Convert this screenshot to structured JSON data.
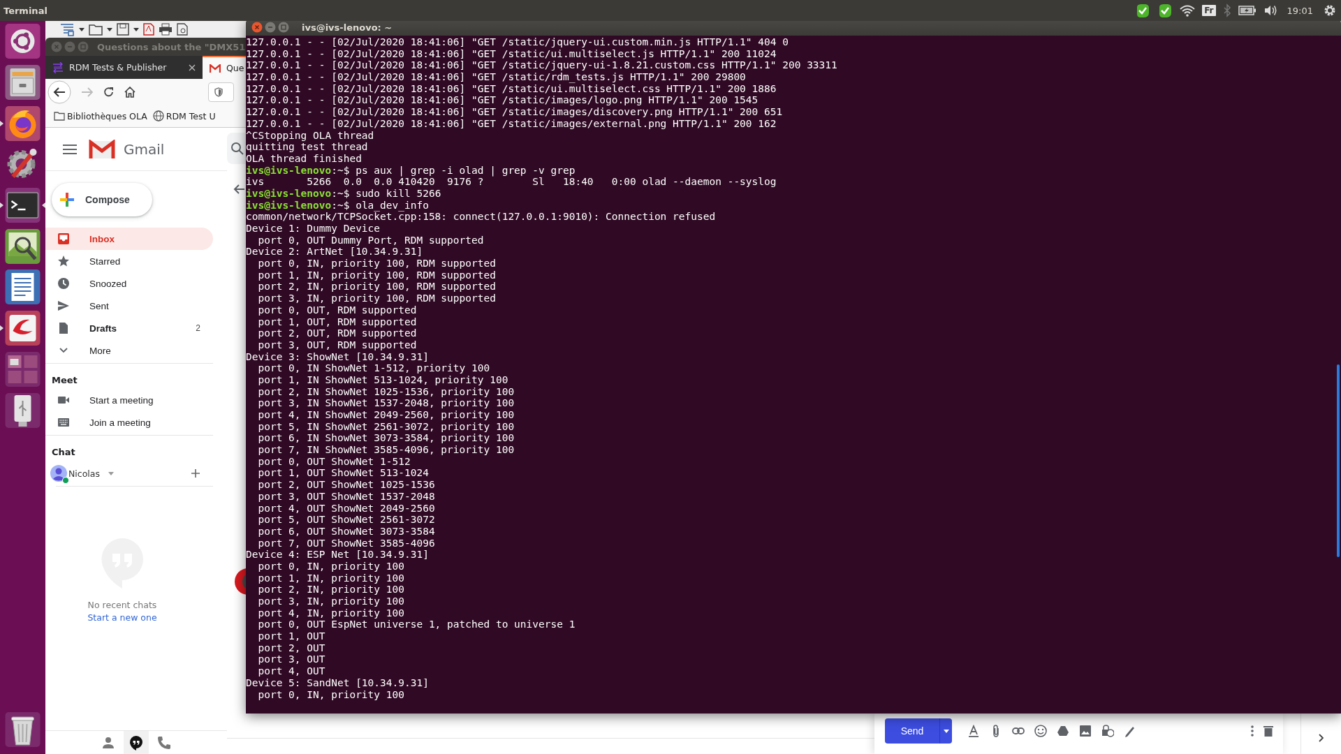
{
  "top_panel": {
    "app_title": "Terminal",
    "indicators": [
      {
        "kind": "check"
      },
      {
        "kind": "check"
      },
      {
        "kind": "wifi"
      },
      {
        "kind": "keyboard",
        "text": "Fr"
      },
      {
        "kind": "bluetooth"
      },
      {
        "kind": "battery"
      },
      {
        "kind": "volume"
      },
      {
        "kind": "clock",
        "text": "19:01"
      },
      {
        "kind": "power"
      }
    ]
  },
  "launcher": {
    "items": [
      {
        "kind": "ubuntu",
        "running": false,
        "focused": false
      },
      {
        "kind": "files",
        "running": false,
        "focused": false
      },
      {
        "kind": "firefox",
        "running": true,
        "focused": false
      },
      {
        "kind": "settings",
        "running": false,
        "focused": false
      },
      {
        "kind": "terminal",
        "running": true,
        "focused": true
      },
      {
        "kind": "imageviewer",
        "running": false,
        "focused": false
      },
      {
        "kind": "writer",
        "running": false,
        "focused": false
      },
      {
        "kind": "reader",
        "running": true,
        "focused": false
      },
      {
        "kind": "workspaces",
        "running": false,
        "focused": false
      },
      {
        "kind": "usb",
        "running": false,
        "focused": false
      }
    ],
    "trash": {
      "kind": "trash"
    }
  },
  "browser": {
    "window_title": "Questions about the \"DMX51",
    "tabs": [
      {
        "label": "RDM Tests & Publisher",
        "kind": "rdm",
        "selected": false
      },
      {
        "label": "Que",
        "kind": "gmail",
        "selected": true
      }
    ],
    "bookmarks": [
      {
        "label": "Bibliothèques OLA",
        "kind": "folder"
      },
      {
        "label": "RDM Test U",
        "kind": "globe"
      }
    ]
  },
  "gmail": {
    "brand": "Gmail",
    "compose": "Compose",
    "nav": [
      {
        "label": "Inbox",
        "kind": "inbox",
        "selected": true,
        "bold": true
      },
      {
        "label": "Starred",
        "kind": "star",
        "selected": false,
        "bold": false
      },
      {
        "label": "Snoozed",
        "kind": "clock",
        "selected": false,
        "bold": false
      },
      {
        "label": "Sent",
        "kind": "send",
        "selected": false,
        "bold": false
      },
      {
        "label": "Drafts",
        "kind": "draft",
        "selected": false,
        "bold": true,
        "count": "2"
      },
      {
        "label": "More",
        "kind": "more",
        "selected": false,
        "bold": false
      }
    ],
    "meet": {
      "heading": "Meet",
      "items": [
        {
          "label": "Start a meeting",
          "kind": "video"
        },
        {
          "label": "Join a meeting",
          "kind": "keyboard"
        }
      ]
    },
    "chat": {
      "heading": "Chat",
      "user": "Nicolas",
      "online": true,
      "empty_text": "No recent chats",
      "link": "Start a new one"
    },
    "bottom_tabs": [
      {
        "kind": "people",
        "selected": false
      },
      {
        "kind": "hangouts",
        "selected": true
      },
      {
        "kind": "phone",
        "selected": false
      }
    ],
    "send": "Send"
  },
  "terminal": {
    "title": "ivs@ivs-lenovo: ~",
    "lines": [
      {
        "kind": "output",
        "text": "127.0.0.1 - - [02/Jul/2020 18:41:06] \"GET /static/jquery-ui.custom.min.js HTTP/1.1\" 404 0"
      },
      {
        "kind": "output",
        "text": "127.0.0.1 - - [02/Jul/2020 18:41:06] \"GET /static/ui.multiselect.js HTTP/1.1\" 200 11024"
      },
      {
        "kind": "output",
        "text": "127.0.0.1 - - [02/Jul/2020 18:41:06] \"GET /static/jquery-ui-1.8.21.custom.css HTTP/1.1\" 200 33311"
      },
      {
        "kind": "output",
        "text": "127.0.0.1 - - [02/Jul/2020 18:41:06] \"GET /static/rdm_tests.js HTTP/1.1\" 200 29800"
      },
      {
        "kind": "output",
        "text": "127.0.0.1 - - [02/Jul/2020 18:41:06] \"GET /static/ui.multiselect.css HTTP/1.1\" 200 1886"
      },
      {
        "kind": "output",
        "text": "127.0.0.1 - - [02/Jul/2020 18:41:06] \"GET /static/images/logo.png HTTP/1.1\" 200 1545"
      },
      {
        "kind": "output",
        "text": "127.0.0.1 - - [02/Jul/2020 18:41:06] \"GET /static/images/discovery.png HTTP/1.1\" 200 651"
      },
      {
        "kind": "output",
        "text": "127.0.0.1 - - [02/Jul/2020 18:41:06] \"GET /static/images/external.png HTTP/1.1\" 200 162"
      },
      {
        "kind": "output",
        "text": "^CStopping OLA thread"
      },
      {
        "kind": "output",
        "text": "quitting test thread"
      },
      {
        "kind": "output",
        "text": "OLA thread finished"
      },
      {
        "kind": "prompt",
        "user": "ivs@ivs-lenovo",
        "path": ":~$",
        "text": "ps aux | grep -i olad | grep -v grep"
      },
      {
        "kind": "output",
        "text": "ivs       5266  0.0  0.0 410420  9176 ?        Sl   18:40   0:00 olad --daemon --syslog"
      },
      {
        "kind": "prompt",
        "user": "ivs@ivs-lenovo",
        "path": ":~$",
        "text": "sudo kill 5266"
      },
      {
        "kind": "prompt",
        "user": "ivs@ivs-lenovo",
        "path": ":~$",
        "text": "ola_dev_info"
      },
      {
        "kind": "output",
        "text": "common/network/TCPSocket.cpp:158: connect(127.0.0.1:9010): Connection refused"
      },
      {
        "kind": "output",
        "text": "Device 1: Dummy Device"
      },
      {
        "kind": "output",
        "text": "  port 0, OUT Dummy Port, RDM supported"
      },
      {
        "kind": "output",
        "text": "Device 2: ArtNet [10.34.9.31]"
      },
      {
        "kind": "output",
        "text": "  port 0, IN, priority 100, RDM supported"
      },
      {
        "kind": "output",
        "text": "  port 1, IN, priority 100, RDM supported"
      },
      {
        "kind": "output",
        "text": "  port 2, IN, priority 100, RDM supported"
      },
      {
        "kind": "output",
        "text": "  port 3, IN, priority 100, RDM supported"
      },
      {
        "kind": "output",
        "text": "  port 0, OUT, RDM supported"
      },
      {
        "kind": "output",
        "text": "  port 1, OUT, RDM supported"
      },
      {
        "kind": "output",
        "text": "  port 2, OUT, RDM supported"
      },
      {
        "kind": "output",
        "text": "  port 3, OUT, RDM supported"
      },
      {
        "kind": "output",
        "text": "Device 3: ShowNet [10.34.9.31]"
      },
      {
        "kind": "output",
        "text": "  port 0, IN ShowNet 1-512, priority 100"
      },
      {
        "kind": "output",
        "text": "  port 1, IN ShowNet 513-1024, priority 100"
      },
      {
        "kind": "output",
        "text": "  port 2, IN ShowNet 1025-1536, priority 100"
      },
      {
        "kind": "output",
        "text": "  port 3, IN ShowNet 1537-2048, priority 100"
      },
      {
        "kind": "output",
        "text": "  port 4, IN ShowNet 2049-2560, priority 100"
      },
      {
        "kind": "output",
        "text": "  port 5, IN ShowNet 2561-3072, priority 100"
      },
      {
        "kind": "output",
        "text": "  port 6, IN ShowNet 3073-3584, priority 100"
      },
      {
        "kind": "output",
        "text": "  port 7, IN ShowNet 3585-4096, priority 100"
      },
      {
        "kind": "output",
        "text": "  port 0, OUT ShowNet 1-512"
      },
      {
        "kind": "output",
        "text": "  port 1, OUT ShowNet 513-1024"
      },
      {
        "kind": "output",
        "text": "  port 2, OUT ShowNet 1025-1536"
      },
      {
        "kind": "output",
        "text": "  port 3, OUT ShowNet 1537-2048"
      },
      {
        "kind": "output",
        "text": "  port 4, OUT ShowNet 2049-2560"
      },
      {
        "kind": "output",
        "text": "  port 5, OUT ShowNet 2561-3072"
      },
      {
        "kind": "output",
        "text": "  port 6, OUT ShowNet 3073-3584"
      },
      {
        "kind": "output",
        "text": "  port 7, OUT ShowNet 3585-4096"
      },
      {
        "kind": "output",
        "text": "Device 4: ESP Net [10.34.9.31]"
      },
      {
        "kind": "output",
        "text": "  port 0, IN, priority 100"
      },
      {
        "kind": "output",
        "text": "  port 1, IN, priority 100"
      },
      {
        "kind": "output",
        "text": "  port 2, IN, priority 100"
      },
      {
        "kind": "output",
        "text": "  port 3, IN, priority 100"
      },
      {
        "kind": "output",
        "text": "  port 4, IN, priority 100"
      },
      {
        "kind": "output",
        "text": "  port 0, OUT EspNet universe 1, patched to universe 1"
      },
      {
        "kind": "output",
        "text": "  port 1, OUT"
      },
      {
        "kind": "output",
        "text": "  port 2, OUT"
      },
      {
        "kind": "output",
        "text": "  port 3, OUT"
      },
      {
        "kind": "output",
        "text": "  port 4, OUT"
      },
      {
        "kind": "output",
        "text": "Device 5: SandNet [10.34.9.31]"
      },
      {
        "kind": "output",
        "text": "  port 0, IN, priority 100"
      }
    ]
  }
}
